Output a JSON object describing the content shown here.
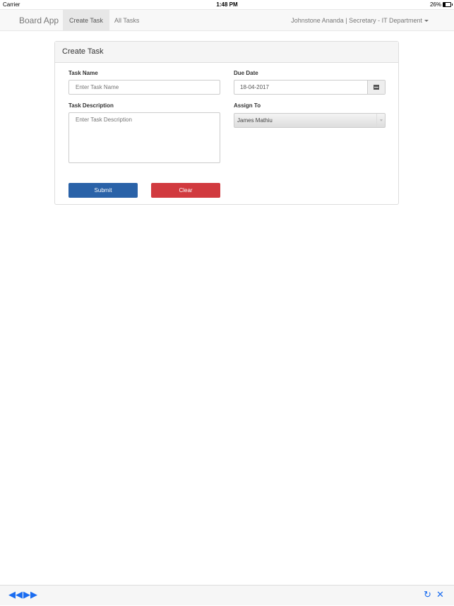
{
  "statusbar": {
    "carrier": "Carrier",
    "time": "1:48 PM",
    "battery": "26%"
  },
  "navbar": {
    "brand": "Board App",
    "items": [
      {
        "label": "Create Task",
        "active": true
      },
      {
        "label": "All Tasks",
        "active": false
      }
    ],
    "user_menu": "Johnstone Ananda | Secretary - IT Department"
  },
  "panel": {
    "title": "Create Task",
    "task_name": {
      "label": "Task Name",
      "placeholder": "Enter Task Name",
      "value": ""
    },
    "due_date": {
      "label": "Due Date",
      "value": "18-04-2017",
      "icon": "calendar-icon"
    },
    "task_description": {
      "label": "Task Description",
      "placeholder": "Enter Task Description",
      "value": ""
    },
    "assign_to": {
      "label": "Assign To",
      "selected": "James Mathiu"
    },
    "submit_label": "Submit",
    "clear_label": "Clear"
  },
  "bottombar": {
    "icons": [
      "rewind-icon",
      "fast-forward-icon",
      "refresh-icon",
      "close-icon"
    ]
  },
  "colors": {
    "primary": "#2a62a8",
    "danger": "#d13a3f",
    "ios_blue": "#1a6cf0"
  }
}
